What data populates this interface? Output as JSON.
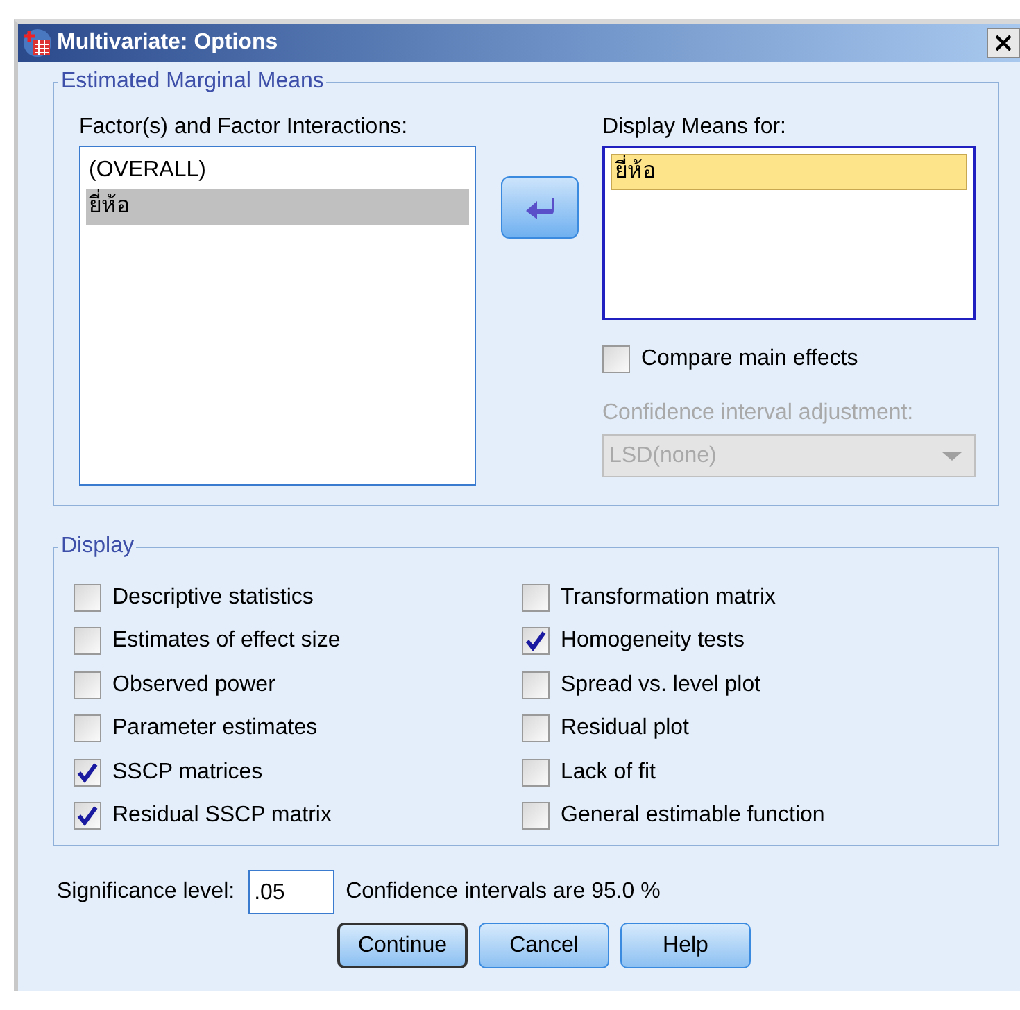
{
  "window": {
    "title": "Multivariate: Options"
  },
  "estimated_marginal_means": {
    "title": "Estimated Marginal Means",
    "factors": {
      "label": "Factor(s) and Factor Interactions:",
      "items": [
        {
          "text": "(OVERALL)",
          "selected": false
        },
        {
          "text": "ยี่ห้อ",
          "selected": true
        }
      ]
    },
    "display_means": {
      "label": "Display Means for:",
      "items": [
        {
          "text": "ยี่ห้อ",
          "selected": true
        }
      ]
    },
    "compare_main_effects": {
      "label": "Compare main effects",
      "checked": false
    },
    "confidence_adjustment": {
      "label": "Confidence interval adjustment:",
      "value": "LSD(none)",
      "disabled": true
    }
  },
  "display": {
    "title": "Display",
    "options": [
      {
        "label": "Descriptive statistics",
        "checked": false
      },
      {
        "label": "Estimates of effect size",
        "checked": false
      },
      {
        "label": "Observed power",
        "checked": false
      },
      {
        "label": "Parameter estimates",
        "checked": false
      },
      {
        "label": "SSCP matrices",
        "checked": true
      },
      {
        "label": "Residual SSCP matrix",
        "checked": true
      },
      {
        "label": "Transformation matrix",
        "checked": false
      },
      {
        "label": "Homogeneity tests",
        "checked": true
      },
      {
        "label": "Spread vs. level plot",
        "checked": false
      },
      {
        "label": "Residual plot",
        "checked": false
      },
      {
        "label": "Lack of fit",
        "checked": false
      },
      {
        "label": "General estimable function",
        "checked": false
      }
    ]
  },
  "significance": {
    "label": "Significance level:",
    "value": ".05",
    "note": "Confidence intervals are 95.0 %"
  },
  "buttons": [
    {
      "label": "Continue",
      "default": true
    },
    {
      "label": "Cancel",
      "default": false
    },
    {
      "label": "Help",
      "default": false
    }
  ]
}
